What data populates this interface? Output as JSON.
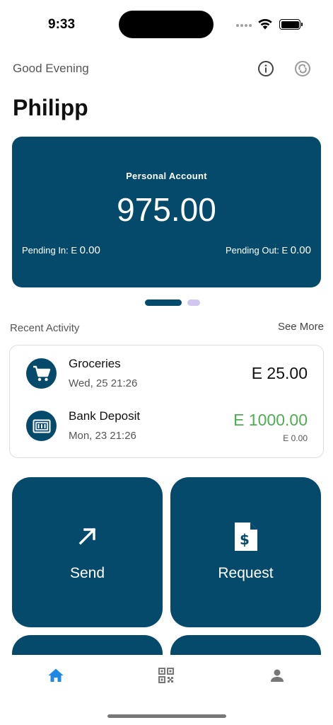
{
  "status_bar": {
    "time": "9:33"
  },
  "header": {
    "greeting": "Good Evening",
    "name": "Philipp"
  },
  "card": {
    "title": "Personal Account",
    "balance": "975.00",
    "pending_in_label": "Pending In: E ",
    "pending_in_amount": "0.00",
    "pending_out_label": "Pending Out: E ",
    "pending_out_amount": "0.00"
  },
  "activity": {
    "title": "Recent Activity",
    "see_more": "See More",
    "items": [
      {
        "title": "Groceries",
        "date": "Wed, 25 21:26",
        "amount": "E 25.00",
        "icon": "cart-icon"
      },
      {
        "title": "Bank Deposit",
        "date": "Mon, 23 21:26",
        "amount": "E 1000.00",
        "sub": "E 0.00",
        "icon": "bank-icon"
      }
    ]
  },
  "actions": {
    "send": "Send",
    "request": "Request"
  },
  "colors": {
    "primary": "#064a6b",
    "positive": "#4caf50",
    "accent": "#1e88e5",
    "pager_inactive": "#cfc7ef"
  }
}
